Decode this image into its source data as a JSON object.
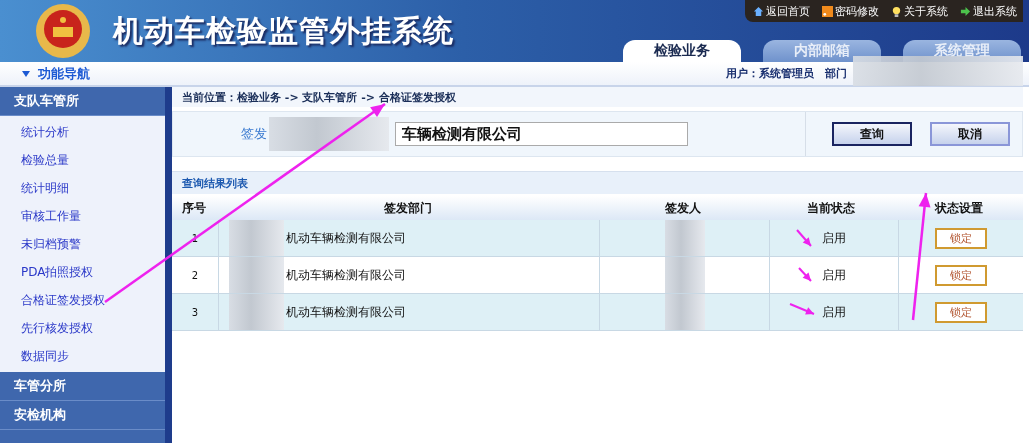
{
  "header": {
    "title": "机动车检验监管外挂系统",
    "links": [
      {
        "kind": "home",
        "label": "返回首页"
      },
      {
        "kind": "rss",
        "label": "密码修改"
      },
      {
        "kind": "bulb",
        "label": "关于系统"
      },
      {
        "kind": "exit",
        "label": "退出系统"
      }
    ],
    "tabs": [
      {
        "label": "检验业务",
        "selected": true
      },
      {
        "label": "内部邮箱",
        "selected": false
      },
      {
        "label": "系统管理",
        "selected": false
      }
    ]
  },
  "nav_title": "功能导航",
  "user_info": "用户：系统管理员　部门",
  "sidebar": {
    "groups": [
      {
        "label": "支队车管所",
        "items": [
          "统计分析",
          "检验总量",
          "统计明细",
          "审核工作量",
          "未归档预警",
          "PDA拍照授权",
          "合格证签发授权",
          "先行核发授权",
          "数据同步"
        ]
      },
      {
        "label": "车管分所"
      },
      {
        "label": "安检机构"
      }
    ]
  },
  "breadcrumb": "当前位置：检验业务 -> 支队车管所 -> 合格证签发授权",
  "search": {
    "label": "签发",
    "value": "车辆检测有限公司",
    "buttons": [
      "查询",
      "取消"
    ]
  },
  "results": {
    "title": "查询结果列表",
    "columns": [
      "序号",
      "签发部门",
      "签发人",
      "当前状态",
      "状态设置"
    ],
    "rows": [
      {
        "index": "1",
        "department": "机动车辆检测有限公司",
        "status": "启用",
        "action": "锁定"
      },
      {
        "index": "2",
        "department": "机动车辆检测有限公司",
        "status": "启用",
        "action": "锁定"
      },
      {
        "index": "3",
        "department": "机动车辆检测有限公司",
        "status": "启用",
        "action": "锁定"
      }
    ]
  }
}
